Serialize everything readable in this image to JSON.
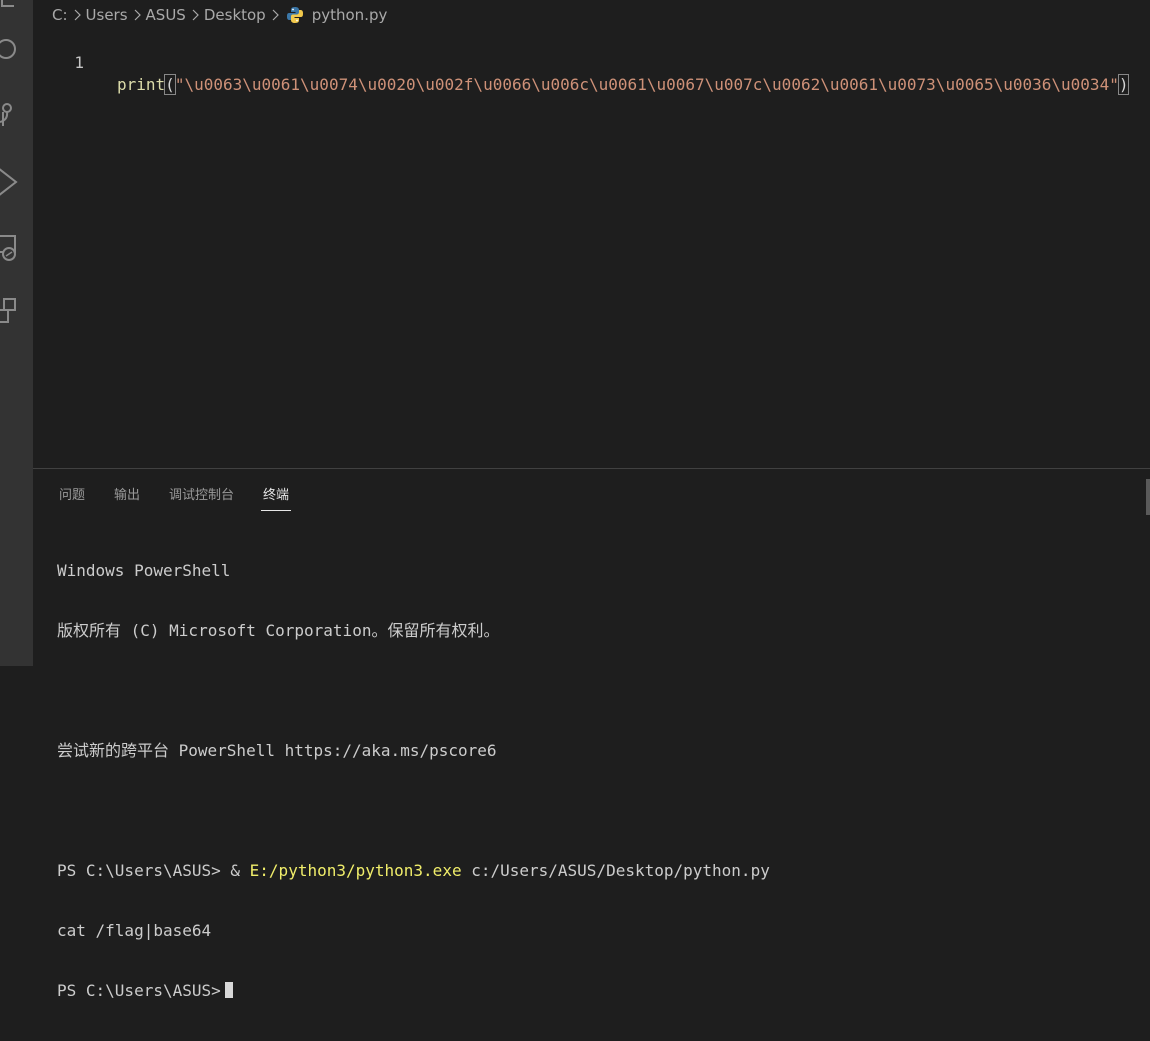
{
  "breadcrumb": {
    "items": [
      "C:",
      "Users",
      "ASUS",
      "Desktop"
    ],
    "file": "python.py"
  },
  "editor": {
    "line_number": "1",
    "code": {
      "function": "print",
      "open_paren": "(",
      "string": "\"\\u0063\\u0061\\u0074\\u0020\\u002f\\u0066\\u006c\\u0061\\u0067\\u007c\\u0062\\u0061\\u0073\\u0065\\u0036\\u0034\"",
      "close_paren": ")"
    }
  },
  "panel": {
    "tabs": [
      "问题",
      "输出",
      "调试控制台",
      "终端"
    ],
    "active_tab": "终端"
  },
  "terminal": {
    "line1": "Windows PowerShell",
    "line2": "版权所有 (C) Microsoft Corporation。保留所有权利。",
    "line3": "尝试新的跨平台 PowerShell https://aka.ms/pscore6",
    "prompt": "PS C:\\Users\\ASUS> & ",
    "exe": "E:/python3/python3.exe",
    "args": " c:/Users/ASUS/Desktop/python.py",
    "output": "cat /flag|base64",
    "prompt2": "PS C:\\Users\\ASUS>"
  },
  "colors": {
    "background": "#1e1e1e",
    "activity_bar": "#333333",
    "function": "#dcdcaa",
    "string": "#ce9178",
    "exe_highlight": "#f0ed6a"
  },
  "icons": [
    "search-icon",
    "source-control-icon",
    "run-debug-icon",
    "remote-explorer-icon",
    "extensions-icon",
    "python-file-icon"
  ]
}
